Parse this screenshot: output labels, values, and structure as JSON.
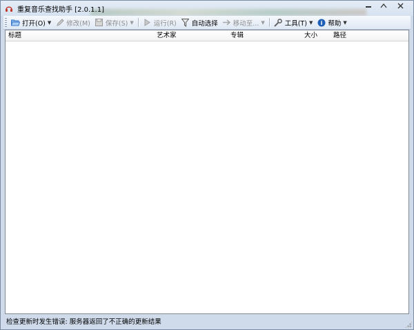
{
  "window": {
    "title": "重复音乐查找助手  [2.0.1.1]"
  },
  "toolbar": {
    "items": [
      {
        "label": "打开(O)",
        "icon": "folder-open-icon",
        "enabled": true,
        "has_dropdown": true
      },
      {
        "label": "修改(M)",
        "icon": "pencil-icon",
        "enabled": false,
        "has_dropdown": false
      },
      {
        "label": "保存(S)",
        "icon": "save-icon",
        "enabled": false,
        "has_dropdown": true
      },
      {
        "label": "运行(R)",
        "icon": "play-icon",
        "enabled": false,
        "has_dropdown": false
      },
      {
        "label": "自动选择",
        "icon": "filter-icon",
        "enabled": true,
        "has_dropdown": false
      },
      {
        "label": "移动至...",
        "icon": "move-icon",
        "enabled": false,
        "has_dropdown": true
      },
      {
        "label": "工具(T)",
        "icon": "wrench-icon",
        "enabled": true,
        "has_dropdown": true
      },
      {
        "label": "帮助",
        "icon": "help-icon",
        "enabled": true,
        "has_dropdown": true
      }
    ]
  },
  "list": {
    "columns": [
      "标题",
      "艺术家",
      "专辑",
      "大小",
      "路径"
    ],
    "rows": []
  },
  "status": {
    "message": "检查更新时发生错误: 服务器返回了不正确的更新结果"
  },
  "colors": {
    "help_icon": "#1e5fb8",
    "folder_icon": "#3c78c8",
    "window_frame": "#d6e2f1"
  }
}
